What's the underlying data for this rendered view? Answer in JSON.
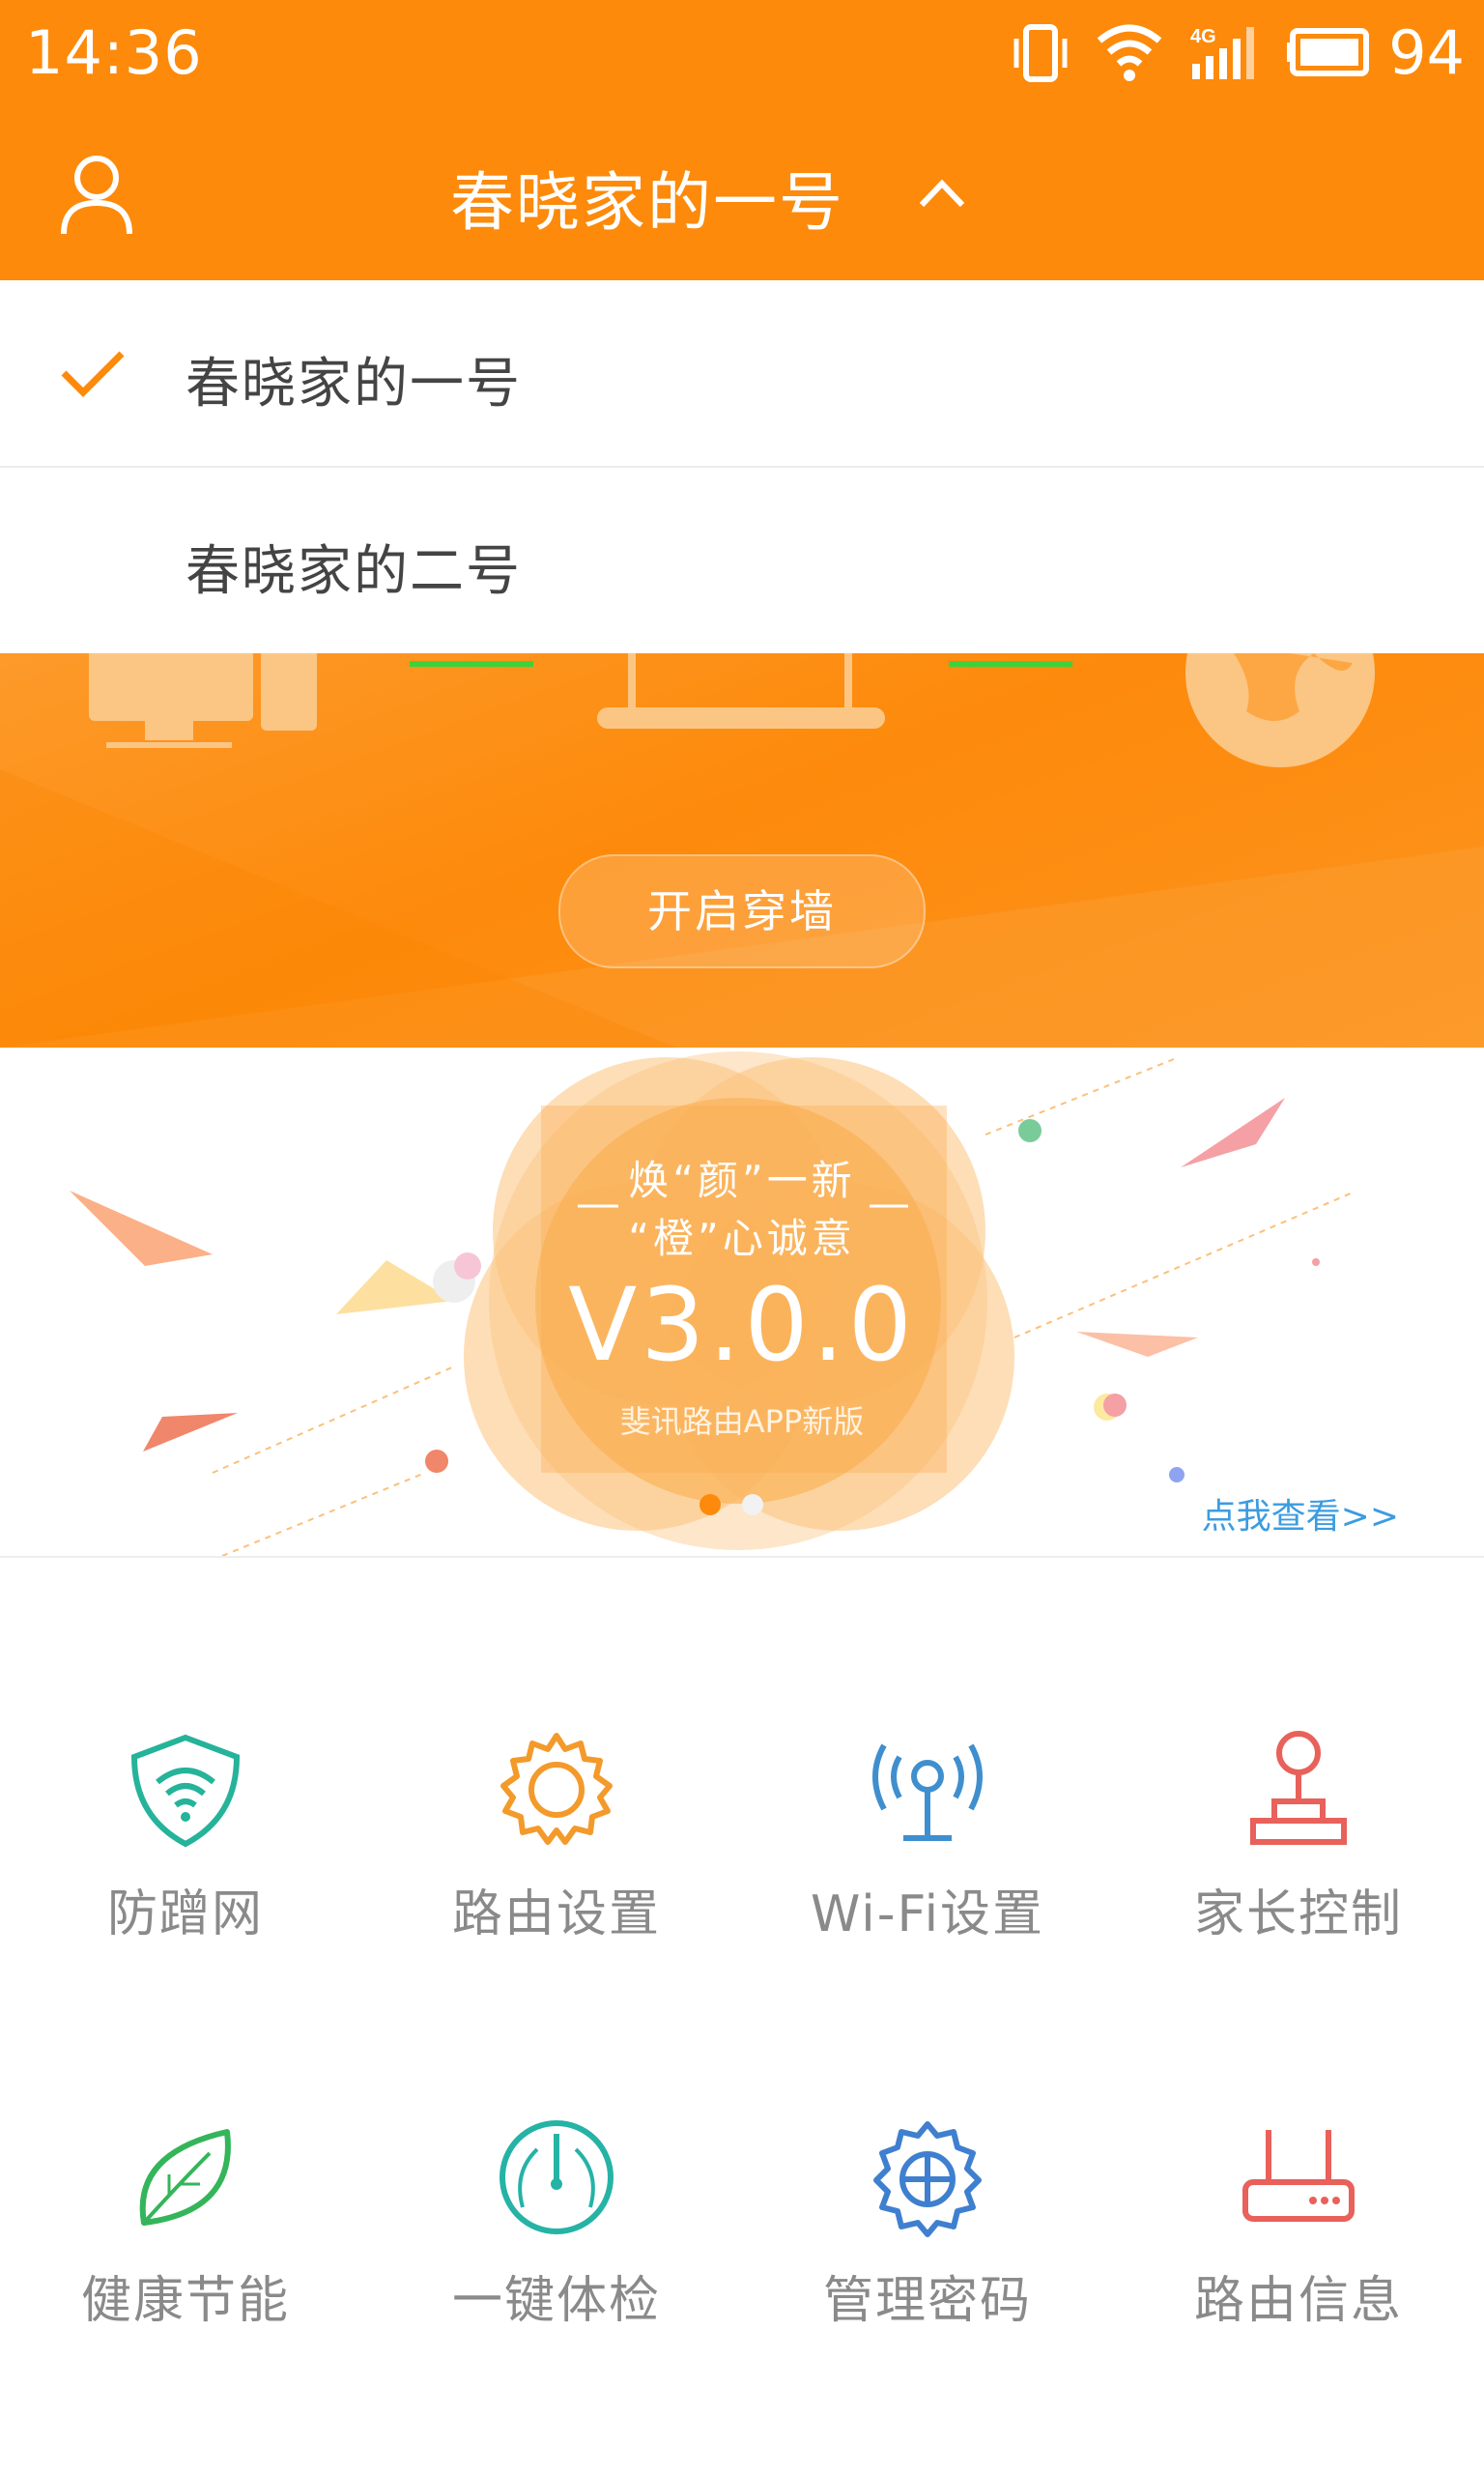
{
  "status_bar": {
    "time": "14:36",
    "network": "4G",
    "battery": "94"
  },
  "header": {
    "title": "春晓家的一号"
  },
  "dropdown": {
    "items": [
      {
        "label": "春晓家的一号",
        "selected": true
      },
      {
        "label": "春晓家的二号",
        "selected": false
      }
    ]
  },
  "hero": {
    "button_label": "开启穿墙"
  },
  "banner": {
    "line1": "焕“颜”一新",
    "line2": "“橙”心诚意",
    "version": "V3.0.0",
    "subtitle": "斐讯路由APP新版",
    "more_link": "点我查看>>",
    "slide_count": 2,
    "active_slide": 1
  },
  "features": [
    {
      "label": "防蹭网",
      "icon": "shield-wifi-icon",
      "color": "#25b39a"
    },
    {
      "label": "路由设置",
      "icon": "gear-icon",
      "color": "#f39a2b"
    },
    {
      "label": "Wi-Fi设置",
      "icon": "wifi-antenna-icon",
      "color": "#3f8fcf"
    },
    {
      "label": "家长控制",
      "icon": "joystick-icon",
      "color": "#e8615a"
    },
    {
      "label": "健康节能",
      "icon": "leaf-icon",
      "color": "#34b55a"
    },
    {
      "label": "一键体检",
      "icon": "gauge-icon",
      "color": "#25b3a6"
    },
    {
      "label": "管理密码",
      "icon": "settings-gear-icon",
      "color": "#3f7fcf"
    },
    {
      "label": "路由信息",
      "icon": "router-icon",
      "color": "#e8615a"
    }
  ]
}
